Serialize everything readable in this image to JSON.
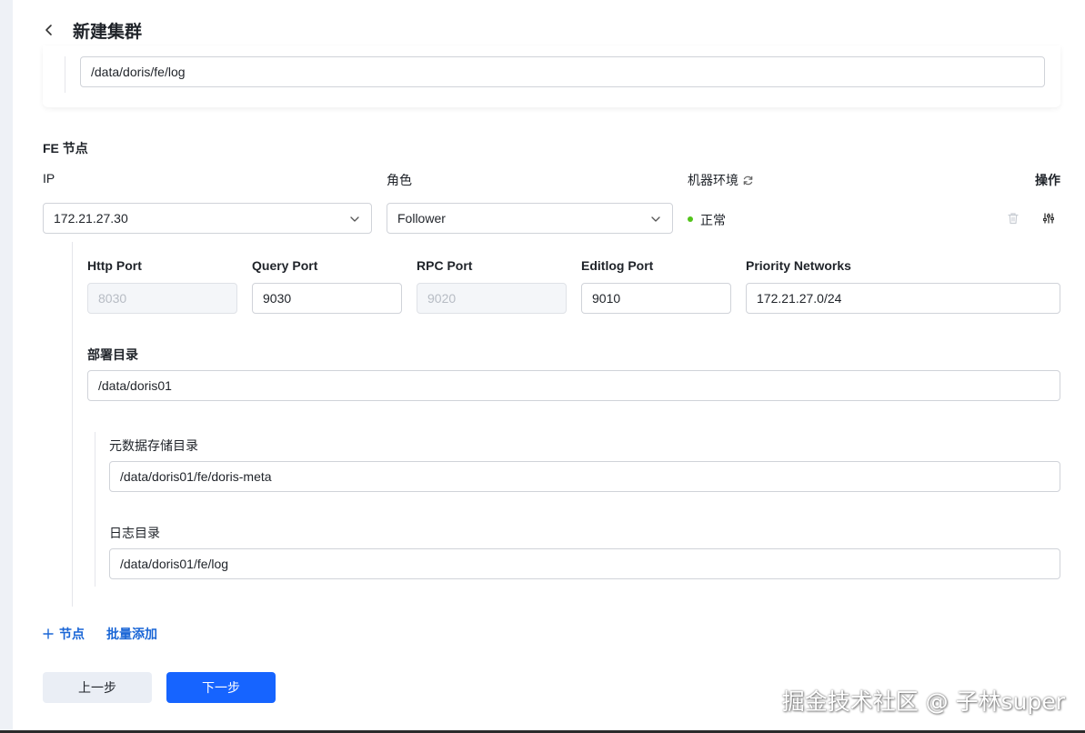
{
  "header": {
    "title": "新建集群"
  },
  "top_card": {
    "log_dir_value": "/data/doris/fe/log"
  },
  "fe_section": {
    "title": "FE 节点",
    "columns": {
      "ip": "IP",
      "role": "角色",
      "env": "机器环境",
      "actions": "操作"
    },
    "node": {
      "ip": "172.21.27.30",
      "role": "Follower",
      "status": "正常",
      "status_color": "#52c41a",
      "ports": {
        "http_label": "Http Port",
        "http_placeholder": "8030",
        "query_label": "Query Port",
        "query_value": "9030",
        "rpc_label": "RPC Port",
        "rpc_placeholder": "9020",
        "editlog_label": "Editlog Port",
        "editlog_value": "9010",
        "priority_label": "Priority Networks",
        "priority_value": "172.21.27.0/24"
      },
      "deploy_dir_label": "部署目录",
      "deploy_dir_value": "/data/doris01",
      "meta_dir_label": "元数据存储目录",
      "meta_dir_value": "/data/doris01/fe/doris-meta",
      "log_dir_label": "日志目录",
      "log_dir_value": "/data/doris01/fe/log"
    },
    "add_node_label": "节点",
    "batch_add_label": "批量添加"
  },
  "footer": {
    "prev_label": "上一步",
    "next_label": "下一步"
  },
  "watermark": "掘金技术社区 @ 子林super",
  "colors": {
    "primary": "#1664ff",
    "link": "#1a66d6",
    "success": "#52c41a"
  }
}
